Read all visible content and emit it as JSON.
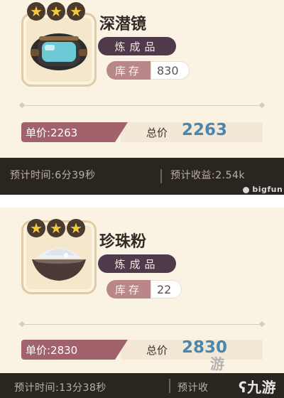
{
  "items": [
    {
      "name": "深潜镜",
      "type_tag": "炼成品",
      "stock_label": "库存",
      "stock_value": "830",
      "stars": [
        "★",
        "★",
        "★"
      ],
      "icon": "diving-goggles-icon",
      "unit_price_text": "单价:2263",
      "total_label": "总价",
      "total_value": "2263",
      "est_time": "预计时间:6分39秒",
      "est_income": "预计收益:2.54k"
    },
    {
      "name": "珍珠粉",
      "type_tag": "炼成品",
      "stock_label": "库存",
      "stock_value": "22",
      "stars": [
        "★",
        "★",
        "★"
      ],
      "icon": "pearl-powder-bowl-icon",
      "unit_price_text": "单价:2830",
      "total_label": "总价",
      "total_value": "2830",
      "est_time": "预计时间:13分38秒",
      "est_income": "预计收"
    }
  ],
  "watermarks": {
    "bigfun": "bigfun",
    "you": "游",
    "jiuyou": "九游"
  },
  "colors": {
    "card_bg": "#faf3e3",
    "dark_band": "#2b2520",
    "type_tag": "#4f3a4b",
    "stock_label": "#b9868a",
    "unit_price": "#a2626b",
    "total_value": "#4b86ae"
  }
}
